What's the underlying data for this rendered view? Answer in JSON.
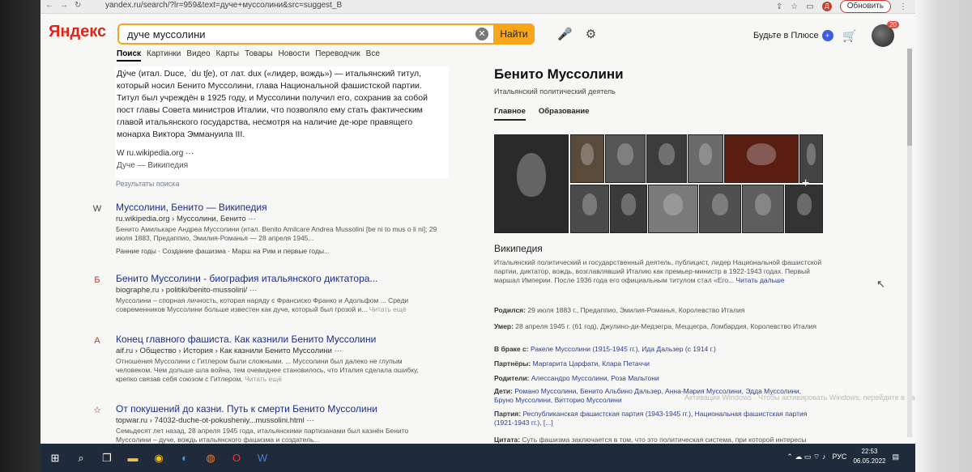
{
  "browser": {
    "url": "yandex.ru/search/?lr=959&text=дуче+муссолини&src=suggest_B",
    "update_label": "Обновить",
    "profile_initial": "Д"
  },
  "header": {
    "logo_text": "Яндекс",
    "search_value": "дуче муссолини",
    "search_button": "Найти",
    "plus_label": "Будьте в Плюсе",
    "notifications_count": "20"
  },
  "tabs": [
    "Поиск",
    "Картинки",
    "Видео",
    "Карты",
    "Товары",
    "Новости",
    "Переводчик",
    "Все"
  ],
  "snippet": {
    "lines": [
      "Ду́че (итал. Duce, ˈdu tʃe), от лат. dux («лидер, вождь») — итальянский титул,",
      "который носил Бенито Муссолини, глава Национальной фашистской партии.",
      "Титул был учреждён в 1925 году, и Муссолини получил его, сохранив за собой",
      "пост главы Совета министров Италии, что позволяло ему стать фактическим",
      "главой итальянского государства, несмотря на наличие де-юре правящего",
      "монарха Виктора Эммануила III."
    ],
    "source": "W ru.wikipedia.org ···",
    "source_title": "Дуче — Википедия"
  },
  "results_label": "Результаты поиска",
  "results": [
    {
      "icon": "W",
      "title": "Муссолини, Бенито — Википедия",
      "url": "ru.wikipedia.org › Муссолини, Бенито ···",
      "desc": "Бенито Амилькаре Андреа Муссолини (итал. Benito Amilcare Andrea Mussolini [be ni to mus o li ni]; 29 июля 1883, Предаппио, Эмилия-Романья — 28 апреля 1945...",
      "links": "Ранние годы · Создание фашизма · Марш на Рим и первые годы..."
    },
    {
      "icon": "Б",
      "title": "Бенито Муссолини - биография итальянского диктатора...",
      "url": "biographe.ru › politiki/benito-mussolini/ ···",
      "desc": "Муссолини – спорная личность, которая наряду с Франсиско Франко и Адольфом ... Среди современников Муссолини больше известен как дуче, который был грозой и...",
      "more": "Читать ещё"
    },
    {
      "icon": "А",
      "title": "Конец главного фашиста. Как казнили Бенито Муссолини",
      "url": "aif.ru › Общество › История › Как казнили Бенито Муссолини ···",
      "desc": "Отношения Муссолини с Гитлером были сложными. ... Муссолини был далеко не глупым человеком. Чем дольше шла война, тем очевиднее становилось, что Италия сделала ошибку, крепко связав себя союзом с Гитлером.",
      "more": "Читать ещё"
    },
    {
      "icon": "☆",
      "title": "От покушений до казни. Путь к смерти Бенито Муссолини",
      "url": "topwar.ru › 74032-duche-ot-pokusheniy...mussolini.html ···",
      "desc": "Семьдесят лет назад, 28 апреля 1945 года, итальянскими партизанами был казнён Бенито Муссолини – дуче, вождь итальянского фашизма и создатель..."
    }
  ],
  "knowledge_panel": {
    "title": "Бенито Муссолини",
    "subtitle": "Итальянский политический деятель",
    "tabs": [
      "Главное",
      "Образование"
    ],
    "wiki_heading": "Википедия",
    "wiki_text": "Итальянский политический и государственный деятель, публицист, лидер Национальной фашистской партии, диктатор, вождь, возглавлявший Италию как премьер-министр в 1922-1943 годах. Первый маршал Империи. После 1936 года его официальным титулом стал «Его...",
    "wiki_more": "Читать дальше",
    "facts": [
      {
        "label": "Родился:",
        "value": "29 июля 1883 г., Предаппио, Эмилия-Романья, Королевство Италия"
      },
      {
        "label": "Умер:",
        "value": "28 апреля 1945 г. (61 год), Джулино-ди-Медзегра, Меццегра, Ломбардия, Королевство Италия"
      },
      {
        "label": "В браке с:",
        "value": "Ракеле Муссолини (1915-1945 гг.), Ида Дальзер (с 1914 г.)"
      },
      {
        "label": "Партнёры:",
        "value": "Маргарита Царфати, Клара Петаччи"
      },
      {
        "label": "Родители:",
        "value": "Алессандро Муссолини, Роза Мальтони"
      },
      {
        "label": "Дети:",
        "value": "Романо Муссолини, Бенито Альбино Дальзер, Анна-Мария Муссолини, Эдда Муссолини, Бруно Муссолини, Витторио Муссолини"
      },
      {
        "label": "Партия:",
        "value": "Республиканская фашистская партия (1943-1945 гг.), Национальная фашистская партия (1921-1943 гг.), [...]"
      },
      {
        "label": "Цитата:",
        "value": "Суть фашизма заключается в том, что это политическая система, при которой интересы"
      }
    ]
  },
  "overlay_hint": "Активация Windows · Чтобы активировать Windows, перейдите в раздел",
  "taskbar": {
    "language": "РУС",
    "time": "22:53",
    "date": "06.05.2022"
  }
}
